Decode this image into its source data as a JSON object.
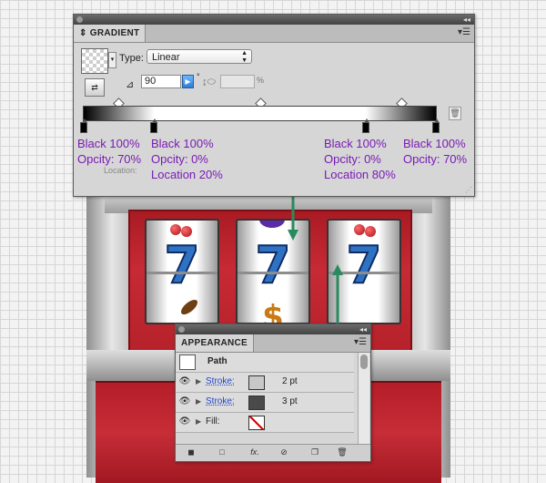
{
  "gradient_panel": {
    "tab": "GRADIENT",
    "type_label": "Type:",
    "type_value": "Linear",
    "angle_value": "90",
    "degree_symbol": "°",
    "percent_symbol": "%",
    "location_label": "Location:",
    "stops": [
      {
        "color_line": "Black 100%",
        "opacity_line": "Opcity: 70%",
        "location_line": ""
      },
      {
        "color_line": "Black 100%",
        "opacity_line": "Opcity: 0%",
        "location_line": "Location 20%"
      },
      {
        "color_line": "Black 100%",
        "opacity_line": "Opcity: 0%",
        "location_line": "Location 80%"
      },
      {
        "color_line": "Black 100%",
        "opacity_line": "Opcity: 70%",
        "location_line": ""
      }
    ]
  },
  "appearance_panel": {
    "tab": "APPEARANCE",
    "path_label": "Path",
    "rows": [
      {
        "label": "Stroke:",
        "weight": "2 pt",
        "color": "#c8c8c8"
      },
      {
        "label": "Stroke:",
        "weight": "3 pt",
        "color": "#4a4a4a"
      },
      {
        "label": "Fill:",
        "weight": "",
        "color": "none"
      }
    ]
  },
  "artwork": {
    "reel_symbol": "7",
    "dollar_symbol": "$"
  },
  "colors": {
    "annotation_text": "#7a1bb5",
    "guide_arrow": "#2a8a5e",
    "cabinet_red": "#c62d37",
    "seven_blue": "#2f72c4"
  },
  "icons": [
    "gradient-swatch-icon",
    "reverse-gradient-icon",
    "angle-icon",
    "aspect-ratio-icon",
    "trash-icon",
    "eye-icon",
    "panel-menu-icon",
    "new-art-icon",
    "fx-icon",
    "clear-icon",
    "duplicate-icon"
  ]
}
